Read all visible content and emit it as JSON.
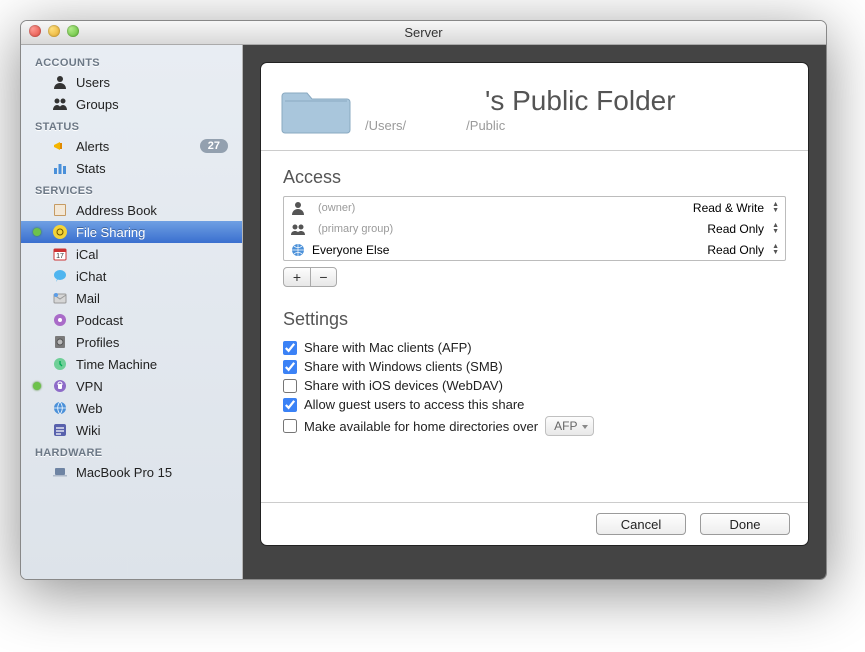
{
  "window": {
    "title": "Server"
  },
  "sidebar": {
    "sections": [
      {
        "header": "ACCOUNTS",
        "items": [
          {
            "label": "Users",
            "icon": "user-icon"
          },
          {
            "label": "Groups",
            "icon": "group-icon"
          }
        ]
      },
      {
        "header": "STATUS",
        "items": [
          {
            "label": "Alerts",
            "icon": "megaphone-icon",
            "badge": "27"
          },
          {
            "label": "Stats",
            "icon": "bars-icon"
          }
        ]
      },
      {
        "header": "SERVICES",
        "items": [
          {
            "label": "Address Book",
            "icon": "addressbook-icon"
          },
          {
            "label": "File Sharing",
            "icon": "filesharing-icon",
            "selected": true,
            "status_dot": true
          },
          {
            "label": "iCal",
            "icon": "ical-icon"
          },
          {
            "label": "iChat",
            "icon": "ichat-icon"
          },
          {
            "label": "Mail",
            "icon": "mail-icon"
          },
          {
            "label": "Podcast",
            "icon": "podcast-icon"
          },
          {
            "label": "Profiles",
            "icon": "profiles-icon"
          },
          {
            "label": "Time Machine",
            "icon": "timemachine-icon"
          },
          {
            "label": "VPN",
            "icon": "vpn-icon",
            "status_dot": true
          },
          {
            "label": "Web",
            "icon": "web-icon"
          },
          {
            "label": "Wiki",
            "icon": "wiki-icon"
          }
        ]
      },
      {
        "header": "HARDWARE",
        "items": [
          {
            "label": "MacBook Pro 15",
            "icon": "macbook-icon"
          }
        ]
      }
    ]
  },
  "detail": {
    "title_suffix": "'s Public Folder",
    "path_prefix": "/Users/",
    "path_suffix": "/Public",
    "access_header": "Access",
    "access_rows": [
      {
        "name": "",
        "meta": "(owner)",
        "icon": "user-silhouette-icon",
        "perm": "Read & Write"
      },
      {
        "name": "",
        "meta": "(primary group)",
        "icon": "group-silhouette-icon",
        "perm": "Read Only"
      },
      {
        "name": "Everyone Else",
        "meta": "",
        "icon": "globe-icon",
        "perm": "Read Only"
      }
    ],
    "settings_header": "Settings",
    "checkboxes": [
      {
        "label": "Share with Mac clients (AFP)",
        "checked": true
      },
      {
        "label": "Share with Windows clients (SMB)",
        "checked": true
      },
      {
        "label": "Share with iOS devices (WebDAV)",
        "checked": false
      },
      {
        "label": "Allow guest users to access this share",
        "checked": true
      },
      {
        "label": "Make available for home directories over",
        "checked": false,
        "trailing_select": "AFP"
      }
    ],
    "buttons": {
      "cancel": "Cancel",
      "done": "Done"
    }
  }
}
